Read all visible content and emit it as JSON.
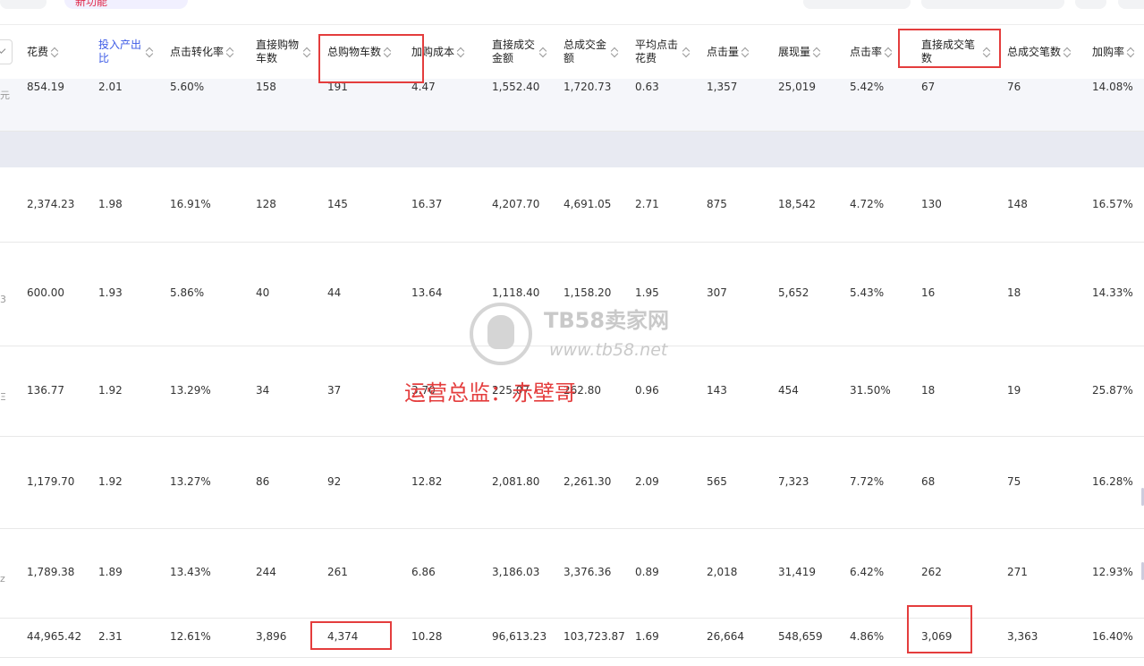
{
  "top": {
    "new_tab_label": "新功能"
  },
  "headers": [
    {
      "label": "花费"
    },
    {
      "label": "投入产出比"
    },
    {
      "label": "点击转化率"
    },
    {
      "label": "直接购物车数"
    },
    {
      "label": "总购物车数"
    },
    {
      "label": "加购成本"
    },
    {
      "label": "直接成交金额"
    },
    {
      "label": "总成交金额"
    },
    {
      "label": "平均点击花费"
    },
    {
      "label": "点击量"
    },
    {
      "label": "展现量"
    },
    {
      "label": "点击率"
    },
    {
      "label": "直接成交笔数"
    },
    {
      "label": "总成交笔数"
    },
    {
      "label": "加购率"
    }
  ],
  "rows": [
    {
      "edge": "元",
      "cells": [
        "854.19",
        "2.01",
        "5.60%",
        "158",
        "191",
        "4.47",
        "1,552.40",
        "1,720.73",
        "0.63",
        "1,357",
        "25,019",
        "5.42%",
        "67",
        "76",
        "14.08%"
      ]
    },
    {
      "edge": "",
      "cells": [
        "2,374.23",
        "1.98",
        "16.91%",
        "128",
        "145",
        "16.37",
        "4,207.70",
        "4,691.05",
        "2.71",
        "875",
        "18,542",
        "4.72%",
        "130",
        "148",
        "16.57%"
      ]
    },
    {
      "edge": "3",
      "cells": [
        "600.00",
        "1.93",
        "5.86%",
        "40",
        "44",
        "13.64",
        "1,118.40",
        "1,158.20",
        "1.95",
        "307",
        "5,652",
        "5.43%",
        "16",
        "18",
        "14.33%"
      ]
    },
    {
      "edge": "Ξ",
      "cells": [
        "136.77",
        "1.92",
        "13.29%",
        "34",
        "37",
        "3.70",
        "225.07",
        "262.80",
        "0.96",
        "143",
        "454",
        "31.50%",
        "18",
        "19",
        "25.87%"
      ]
    },
    {
      "edge": "",
      "cells": [
        "1,179.70",
        "1.92",
        "13.27%",
        "86",
        "92",
        "12.82",
        "2,081.80",
        "2,261.30",
        "2.09",
        "565",
        "7,323",
        "7.72%",
        "68",
        "75",
        "16.28%"
      ]
    },
    {
      "edge": "z",
      "cells": [
        "1,789.38",
        "1.89",
        "13.43%",
        "244",
        "261",
        "6.86",
        "3,186.03",
        "3,376.36",
        "0.89",
        "2,018",
        "31,419",
        "6.42%",
        "262",
        "271",
        "12.93%"
      ]
    },
    {
      "edge": "",
      "cells": [
        "44,965.42",
        "2.31",
        "12.61%",
        "3,896",
        "4,374",
        "10.28",
        "96,613.23",
        "103,723.87",
        "1.69",
        "26,664",
        "548,659",
        "4.86%",
        "3,069",
        "3,363",
        "16.40%"
      ]
    }
  ],
  "watermark": {
    "title": "TB58卖家网",
    "url": "www.tb58.net",
    "caption": "运营总监：赤壁哥"
  },
  "colors": {
    "highlight": "#e43d3d",
    "accent_header": "#3d5be6",
    "band": "#e8eaf2"
  }
}
